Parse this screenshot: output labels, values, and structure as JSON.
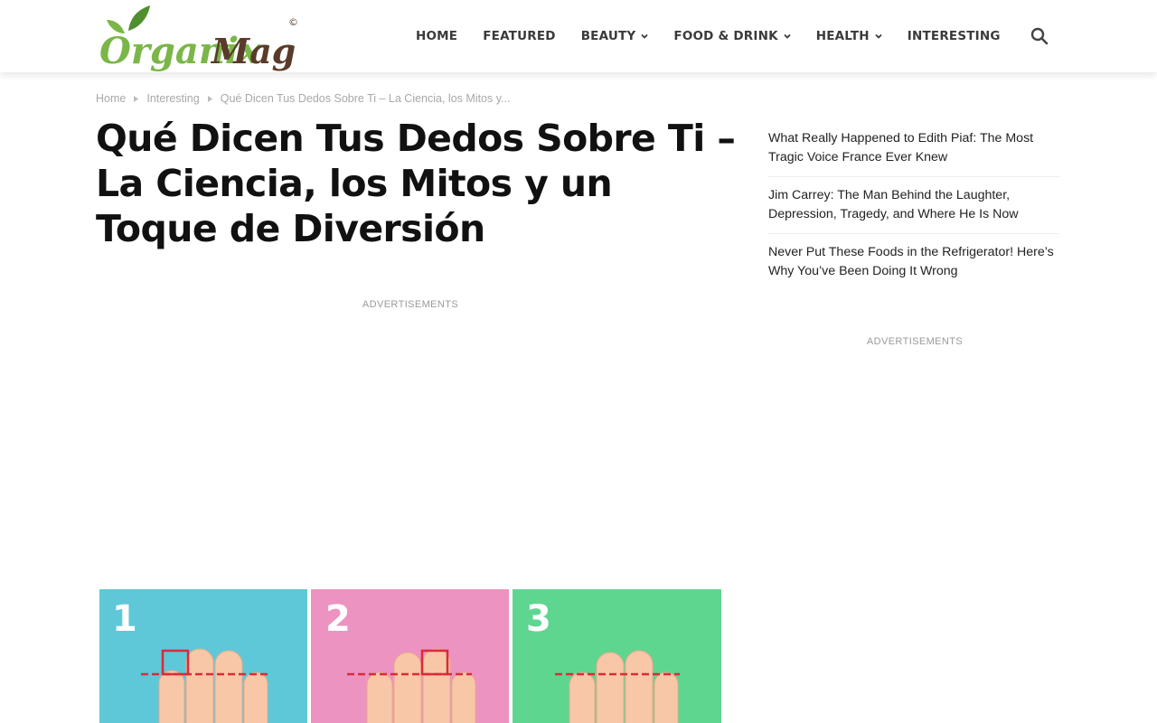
{
  "header": {
    "logo": {
      "text_part1": "Organix",
      "text_part2": "Mag",
      "copyright": "©",
      "green": "#7ab648",
      "brown": "#5a3b2b"
    },
    "nav": [
      {
        "label": "HOME",
        "has_dropdown": false
      },
      {
        "label": "FEATURED",
        "has_dropdown": false
      },
      {
        "label": "BEAUTY",
        "has_dropdown": true
      },
      {
        "label": "FOOD & DRINK",
        "has_dropdown": true
      },
      {
        "label": "HEALTH",
        "has_dropdown": true
      },
      {
        "label": "INTERESTING",
        "has_dropdown": false
      }
    ],
    "search_icon": "search-icon"
  },
  "breadcrumb": {
    "items": [
      "Home",
      "Interesting",
      "Qué Dicen Tus Dedos Sobre Ti – La Ciencia, los Mitos y..."
    ]
  },
  "article": {
    "title": "Qué Dicen Tus Dedos Sobre Ti – La Ciencia, los Mitos y un Toque de Diversión",
    "ad_label": "ADVERTISEMENTS",
    "image": {
      "panels": [
        {
          "number": "1",
          "color": "#5ec8d8"
        },
        {
          "number": "2",
          "color": "#ec93c1"
        },
        {
          "number": "3",
          "color": "#5fd690"
        }
      ]
    }
  },
  "sidebar": {
    "items": [
      "What Really Happened to Edith Piaf: The Most Tragic Voice France Ever Knew",
      "Jim Carrey: The Man Behind the Laughter, Depression, Tragedy, and Where He Is Now",
      "Never Put These Foods in the Refrigerator! Here’s Why You’ve Been Doing It Wrong"
    ],
    "ad_label": "ADVERTISEMENTS"
  }
}
